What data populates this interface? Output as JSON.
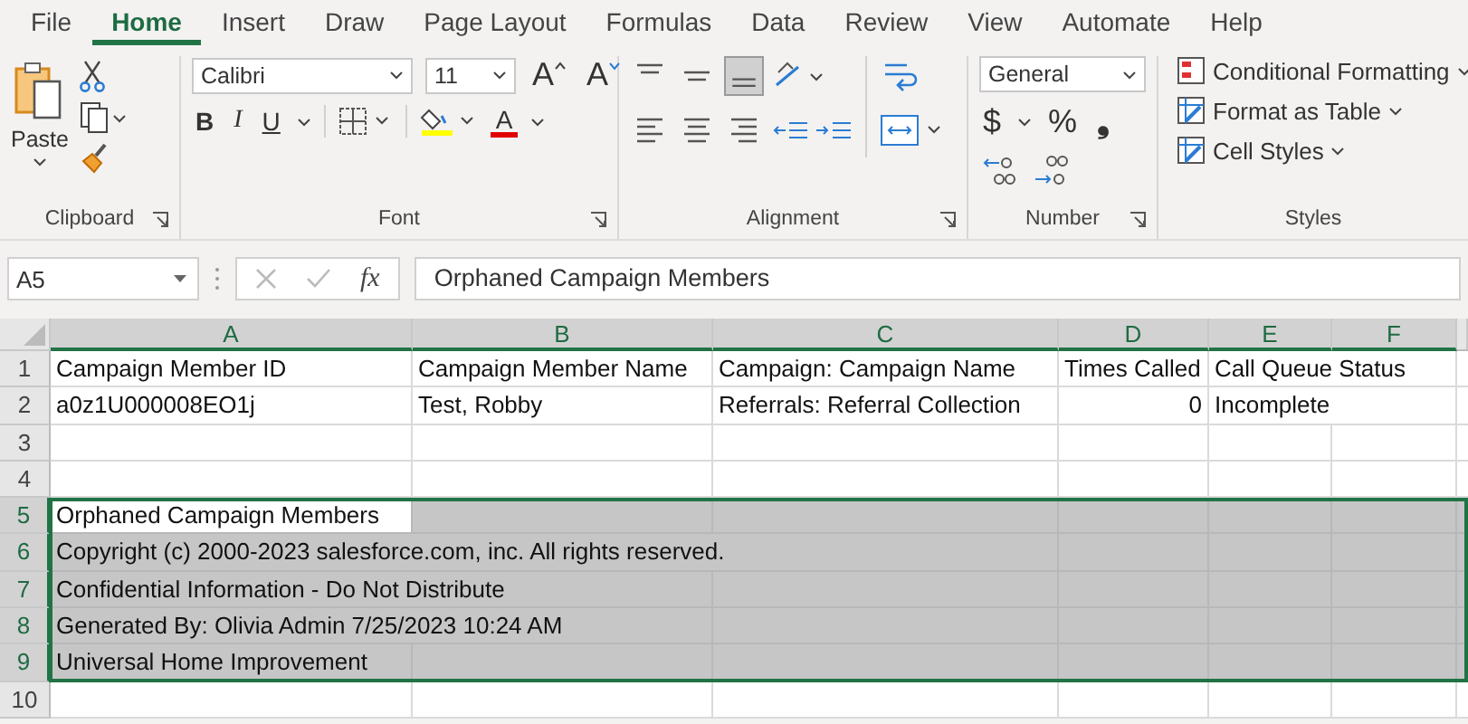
{
  "menu_tabs": [
    {
      "label": "File",
      "selected": false
    },
    {
      "label": "Home",
      "selected": true
    },
    {
      "label": "Insert",
      "selected": false
    },
    {
      "label": "Draw",
      "selected": false
    },
    {
      "label": "Page Layout",
      "selected": false
    },
    {
      "label": "Formulas",
      "selected": false
    },
    {
      "label": "Data",
      "selected": false
    },
    {
      "label": "Review",
      "selected": false
    },
    {
      "label": "View",
      "selected": false
    },
    {
      "label": "Automate",
      "selected": false
    },
    {
      "label": "Help",
      "selected": false
    }
  ],
  "ribbon": {
    "clipboard": {
      "paste": "Paste",
      "label": "Clipboard"
    },
    "font": {
      "name": "Calibri",
      "size": "11",
      "grow": "A",
      "shrink": "A",
      "bold": "B",
      "italic": "I",
      "underline": "U",
      "font_color": "A",
      "label": "Font"
    },
    "alignment": {
      "label": "Alignment"
    },
    "number": {
      "format": "General",
      "currency": "$",
      "percent": "%",
      "comma": "❟",
      "label": "Number"
    },
    "styles": {
      "items": [
        "Conditional Formatting",
        "Format as Table",
        "Cell Styles"
      ],
      "label": "Styles"
    }
  },
  "formula_bar": {
    "name_box": "A5",
    "fx": "fx",
    "value": "Orphaned Campaign Members"
  },
  "sheet": {
    "columns": [
      {
        "label": "A",
        "selected": true
      },
      {
        "label": "B",
        "selected": true
      },
      {
        "label": "C",
        "selected": true
      },
      {
        "label": "D",
        "selected": true
      },
      {
        "label": "E",
        "selected": true
      },
      {
        "label": "F",
        "selected": true
      }
    ],
    "rows": [
      {
        "number": "1",
        "selected": false,
        "cells": {
          "A": {
            "text": "Campaign Member ID"
          },
          "B": {
            "text": "Campaign Member Name"
          },
          "C": {
            "text": "Campaign: Campaign Name"
          },
          "D": {
            "text": "Times Called"
          },
          "E": {
            "text": "Call Queue Status"
          }
        }
      },
      {
        "number": "2",
        "selected": false,
        "cells": {
          "A": {
            "text": "a0z1U000008EO1j"
          },
          "B": {
            "text": "Test, Robby"
          },
          "C": {
            "text": "Referrals: Referral Collection"
          },
          "D": {
            "text": "0",
            "kind": "number"
          },
          "E": {
            "text": "Incomplete"
          }
        }
      },
      {
        "number": "3",
        "selected": false,
        "cells": {}
      },
      {
        "number": "4",
        "selected": false,
        "cells": {}
      },
      {
        "number": "5",
        "selected": true,
        "cells": {
          "A": {
            "text": "Orphaned Campaign Members",
            "active": true
          }
        }
      },
      {
        "number": "6",
        "selected": true,
        "cells": {
          "A": {
            "text": "Copyright (c) 2000-2023 salesforce.com, inc. All rights reserved."
          }
        }
      },
      {
        "number": "7",
        "selected": true,
        "cells": {
          "A": {
            "text": "Confidential Information - Do Not Distribute"
          }
        }
      },
      {
        "number": "8",
        "selected": true,
        "cells": {
          "A": {
            "text": "Generated By:  Olivia Admin  7/25/2023 10:24 AM"
          }
        }
      },
      {
        "number": "9",
        "selected": true,
        "cells": {
          "A": {
            "text": "Universal Home Improvement"
          }
        }
      },
      {
        "number": "10",
        "selected": false,
        "cells": {}
      }
    ]
  }
}
